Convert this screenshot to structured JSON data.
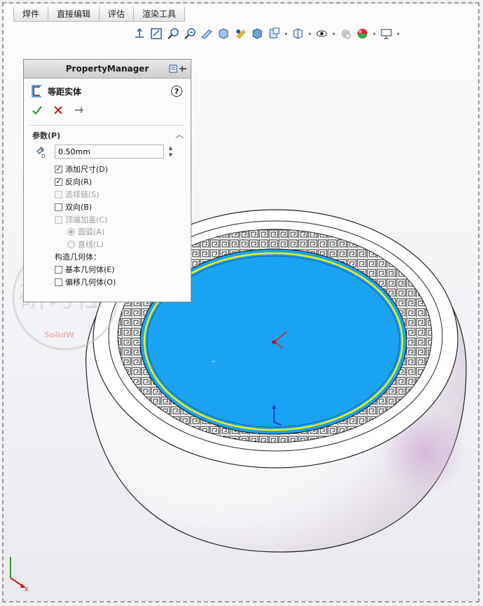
{
  "tabs": [
    "焊件",
    "直接编辑",
    "评估",
    "渲染工具"
  ],
  "toolbar": {
    "icons": [
      "view-orientation-icon",
      "zoom-to-fit-icon",
      "zoom-area-icon",
      "previous-view-icon",
      "section-view-icon",
      "dynamic-annotation-icon",
      "view-style-icon",
      "display-style-icon",
      "hide-show-icon",
      "edit-appearance-icon",
      "apply-scene-icon",
      "view-settings-icon"
    ]
  },
  "property_manager": {
    "header": "PropertyManager",
    "feature_title": "等距实体",
    "help": "?",
    "group_title": "参数(P)",
    "distance_value": "0.50mm",
    "options": {
      "add_dimension": "添加尺寸(D)",
      "reverse": "反向(R)",
      "select_chain": "选择链(S)",
      "bidirectional": "双向(B)",
      "cap_ends": "顶端加盖(C)",
      "arc": "圆弧(A)",
      "line": "直线(L)"
    },
    "construction_label": "构造几何体：",
    "base_geometry": "基本几何体(E)",
    "offset_geometry": "偏移几何体(O)"
  },
  "watermark": {
    "text": "研习社",
    "sub": "SolidW"
  },
  "triad": {
    "axis_x": "X"
  },
  "colors": {
    "sketch_plane": "#1aa3f5",
    "offset_curve": "#f2f200",
    "body": "#ffffff"
  }
}
